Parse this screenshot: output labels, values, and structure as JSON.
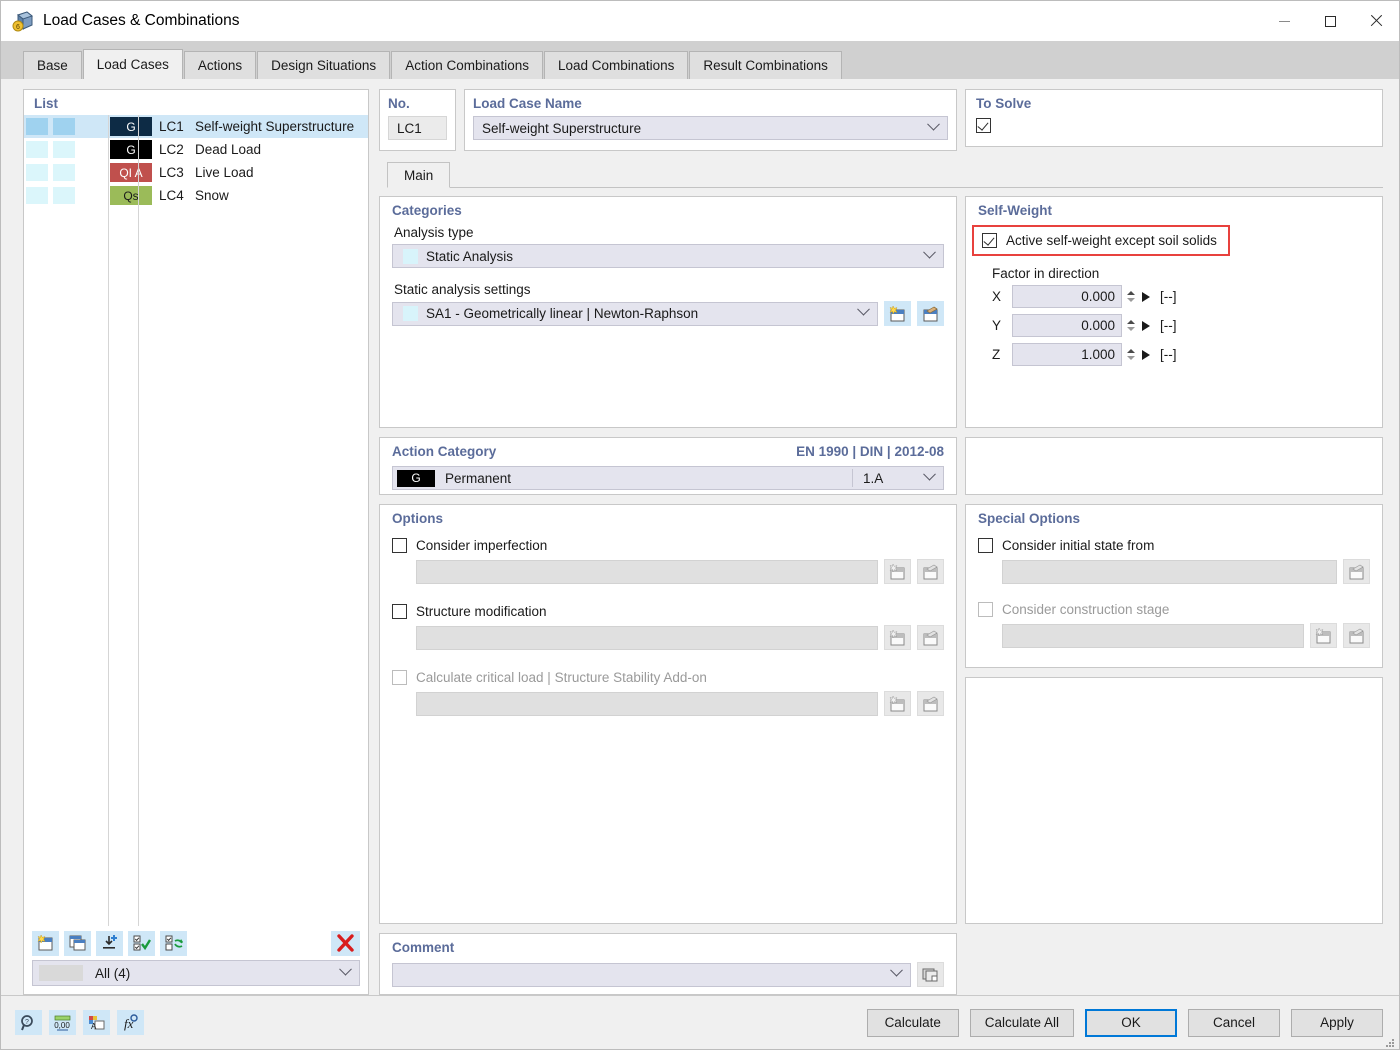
{
  "window": {
    "title": "Load Cases & Combinations",
    "icon": "app-cube-icon",
    "minimize": "minimize-icon",
    "maximize": "maximize-icon",
    "close": "close-icon"
  },
  "tabs": [
    {
      "label": "Base",
      "active": false
    },
    {
      "label": "Load Cases",
      "active": true
    },
    {
      "label": "Actions",
      "active": false
    },
    {
      "label": "Design Situations",
      "active": false
    },
    {
      "label": "Action Combinations",
      "active": false
    },
    {
      "label": "Load Combinations",
      "active": false
    },
    {
      "label": "Result Combinations",
      "active": false
    }
  ],
  "list": {
    "title": "List",
    "rows": [
      {
        "no": "LC1",
        "name": "Self-weight Superstructure",
        "badge": "G",
        "badge_color": "#0d2b45",
        "badge_text_color": "#ffffff",
        "selected": true
      },
      {
        "no": "LC2",
        "name": "Dead Load",
        "badge": "G",
        "badge_color": "#000000",
        "badge_text_color": "#ffffff",
        "selected": false
      },
      {
        "no": "LC3",
        "name": "Live Load",
        "badge": "QI A",
        "badge_color": "#c0504d",
        "badge_text_color": "#ffffff",
        "selected": false
      },
      {
        "no": "LC4",
        "name": "Snow",
        "badge": "Qs",
        "badge_color": "#9bbb59",
        "badge_text_color": "#1a1a1a",
        "selected": false
      }
    ],
    "toolbar": [
      {
        "name": "new-load-case-button"
      },
      {
        "name": "copy-load-case-button"
      },
      {
        "name": "import-load-case-button"
      },
      {
        "name": "select-all-button"
      },
      {
        "name": "invert-selection-button"
      },
      {
        "name": "delete-load-case-button"
      }
    ],
    "filter_value": "All (4)"
  },
  "header": {
    "no_label": "No.",
    "no_value": "LC1",
    "name_label": "Load Case Name",
    "name_value": "Self-weight Superstructure",
    "to_solve_label": "To Solve",
    "to_solve_checked": true
  },
  "subtabs": [
    {
      "label": "Main",
      "active": true
    }
  ],
  "categories": {
    "title": "Categories",
    "analysis_type_label": "Analysis type",
    "analysis_type_value": "Static Analysis",
    "settings_label": "Static analysis settings",
    "settings_value": "SA1 - Geometrically linear | Newton-Raphson",
    "new_button": "new-settings-icon",
    "edit_button": "edit-settings-icon"
  },
  "action_category": {
    "title": "Action Category",
    "standard": "EN 1990 | DIN | 2012-08",
    "badge": "G",
    "badge_color": "#000000",
    "value": "Permanent",
    "code": "1.A"
  },
  "options": {
    "title": "Options",
    "items": [
      {
        "label": "Consider imperfection",
        "checked": false,
        "disabled": false,
        "buttons": 2
      },
      {
        "label": "Structure modification",
        "checked": false,
        "disabled": false,
        "buttons": 2
      },
      {
        "label": "Calculate critical load | Structure Stability Add-on",
        "checked": false,
        "disabled": true,
        "buttons": 2
      }
    ]
  },
  "comment": {
    "title": "Comment",
    "value": "",
    "button": "comment-library-icon"
  },
  "self_weight": {
    "title": "Self-Weight",
    "active_label": "Active self-weight except soil solids",
    "active_checked": true,
    "highlight_color": "#e8413d",
    "factor_label": "Factor in direction",
    "factors": [
      {
        "axis": "X",
        "value": "0.000",
        "unit": "[--]"
      },
      {
        "axis": "Y",
        "value": "0.000",
        "unit": "[--]"
      },
      {
        "axis": "Z",
        "value": "1.000",
        "unit": "[--]"
      }
    ]
  },
  "special_options": {
    "title": "Special Options",
    "items": [
      {
        "label": "Consider initial state from",
        "checked": false,
        "disabled": false,
        "buttons": 1
      },
      {
        "label": "Consider construction stage",
        "checked": false,
        "disabled": true,
        "buttons": 2
      }
    ]
  },
  "footer": {
    "tools": [
      {
        "name": "help-search-icon"
      },
      {
        "name": "units-icon"
      },
      {
        "name": "display-properties-icon"
      },
      {
        "name": "formula-icon"
      }
    ],
    "buttons": [
      {
        "label": "Calculate",
        "primary": false
      },
      {
        "label": "Calculate All",
        "primary": false
      },
      {
        "label": "OK",
        "primary": true
      },
      {
        "label": "Cancel",
        "primary": false
      },
      {
        "label": "Apply",
        "primary": false
      }
    ]
  },
  "colors": {
    "accent": "#0078d7",
    "panel_title": "#5b6c9a",
    "selection": "#cfe7f7",
    "field": "#e4e4ee",
    "highlight": "#e8413d"
  }
}
